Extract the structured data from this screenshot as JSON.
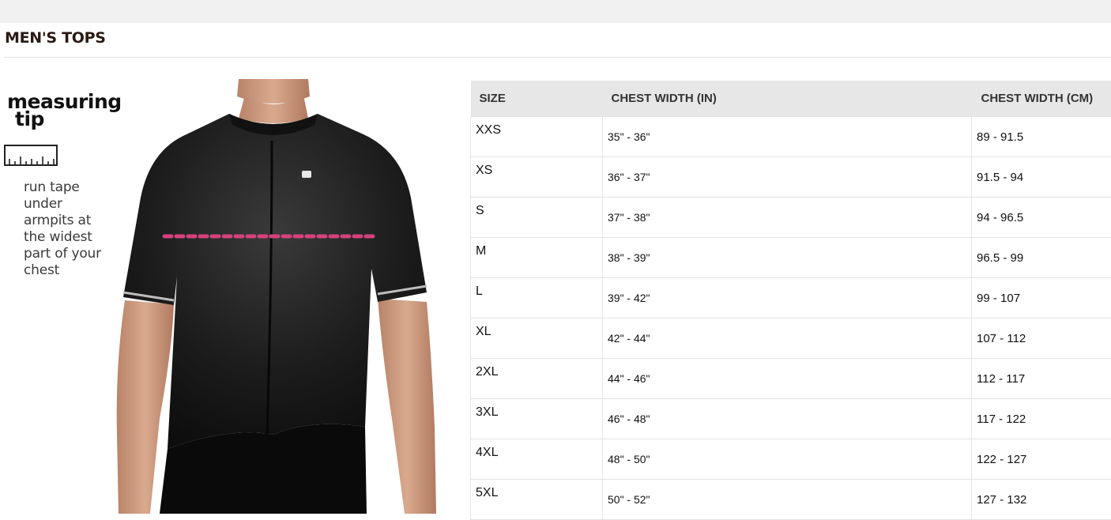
{
  "section": {
    "title": "MEN'S TOPS"
  },
  "measuring_tip": {
    "heading_line1": "measuring",
    "heading_line2": "tip",
    "ruler_icon": "ruler-icon",
    "instruction_lines": [
      "run tape",
      "under",
      "armpits at",
      "the widest",
      "part of your",
      "chest"
    ]
  },
  "illustration": {
    "icon": "jersey-model-illustration",
    "measure_line_color": "#d6417e"
  },
  "table": {
    "headers": [
      "SIZE",
      "CHEST WIDTH (IN)",
      "CHEST WIDTH (CM)"
    ],
    "rows": [
      {
        "size": "XXS",
        "inches": "35\" - 36\"",
        "cm": "89 - 91.5"
      },
      {
        "size": "XS",
        "inches": "36\" - 37\"",
        "cm": "91.5 - 94"
      },
      {
        "size": "S",
        "inches": "37\" - 38\"",
        "cm": "94 - 96.5"
      },
      {
        "size": "M",
        "inches": "38\" - 39\"",
        "cm": "96.5 - 99"
      },
      {
        "size": "L",
        "inches": "39\" - 42\"",
        "cm": "99 - 107"
      },
      {
        "size": "XL",
        "inches": "42\" - 44\"",
        "cm": "107 - 112"
      },
      {
        "size": "2XL",
        "inches": "44\" - 46\"",
        "cm": "112 - 117"
      },
      {
        "size": "3XL",
        "inches": "46\" - 48\"",
        "cm": "117 - 122"
      },
      {
        "size": "4XL",
        "inches": "48\" - 50\"",
        "cm": "122 - 127"
      },
      {
        "size": "5XL",
        "inches": "50\" - 52\"",
        "cm": "127 - 132"
      }
    ]
  }
}
